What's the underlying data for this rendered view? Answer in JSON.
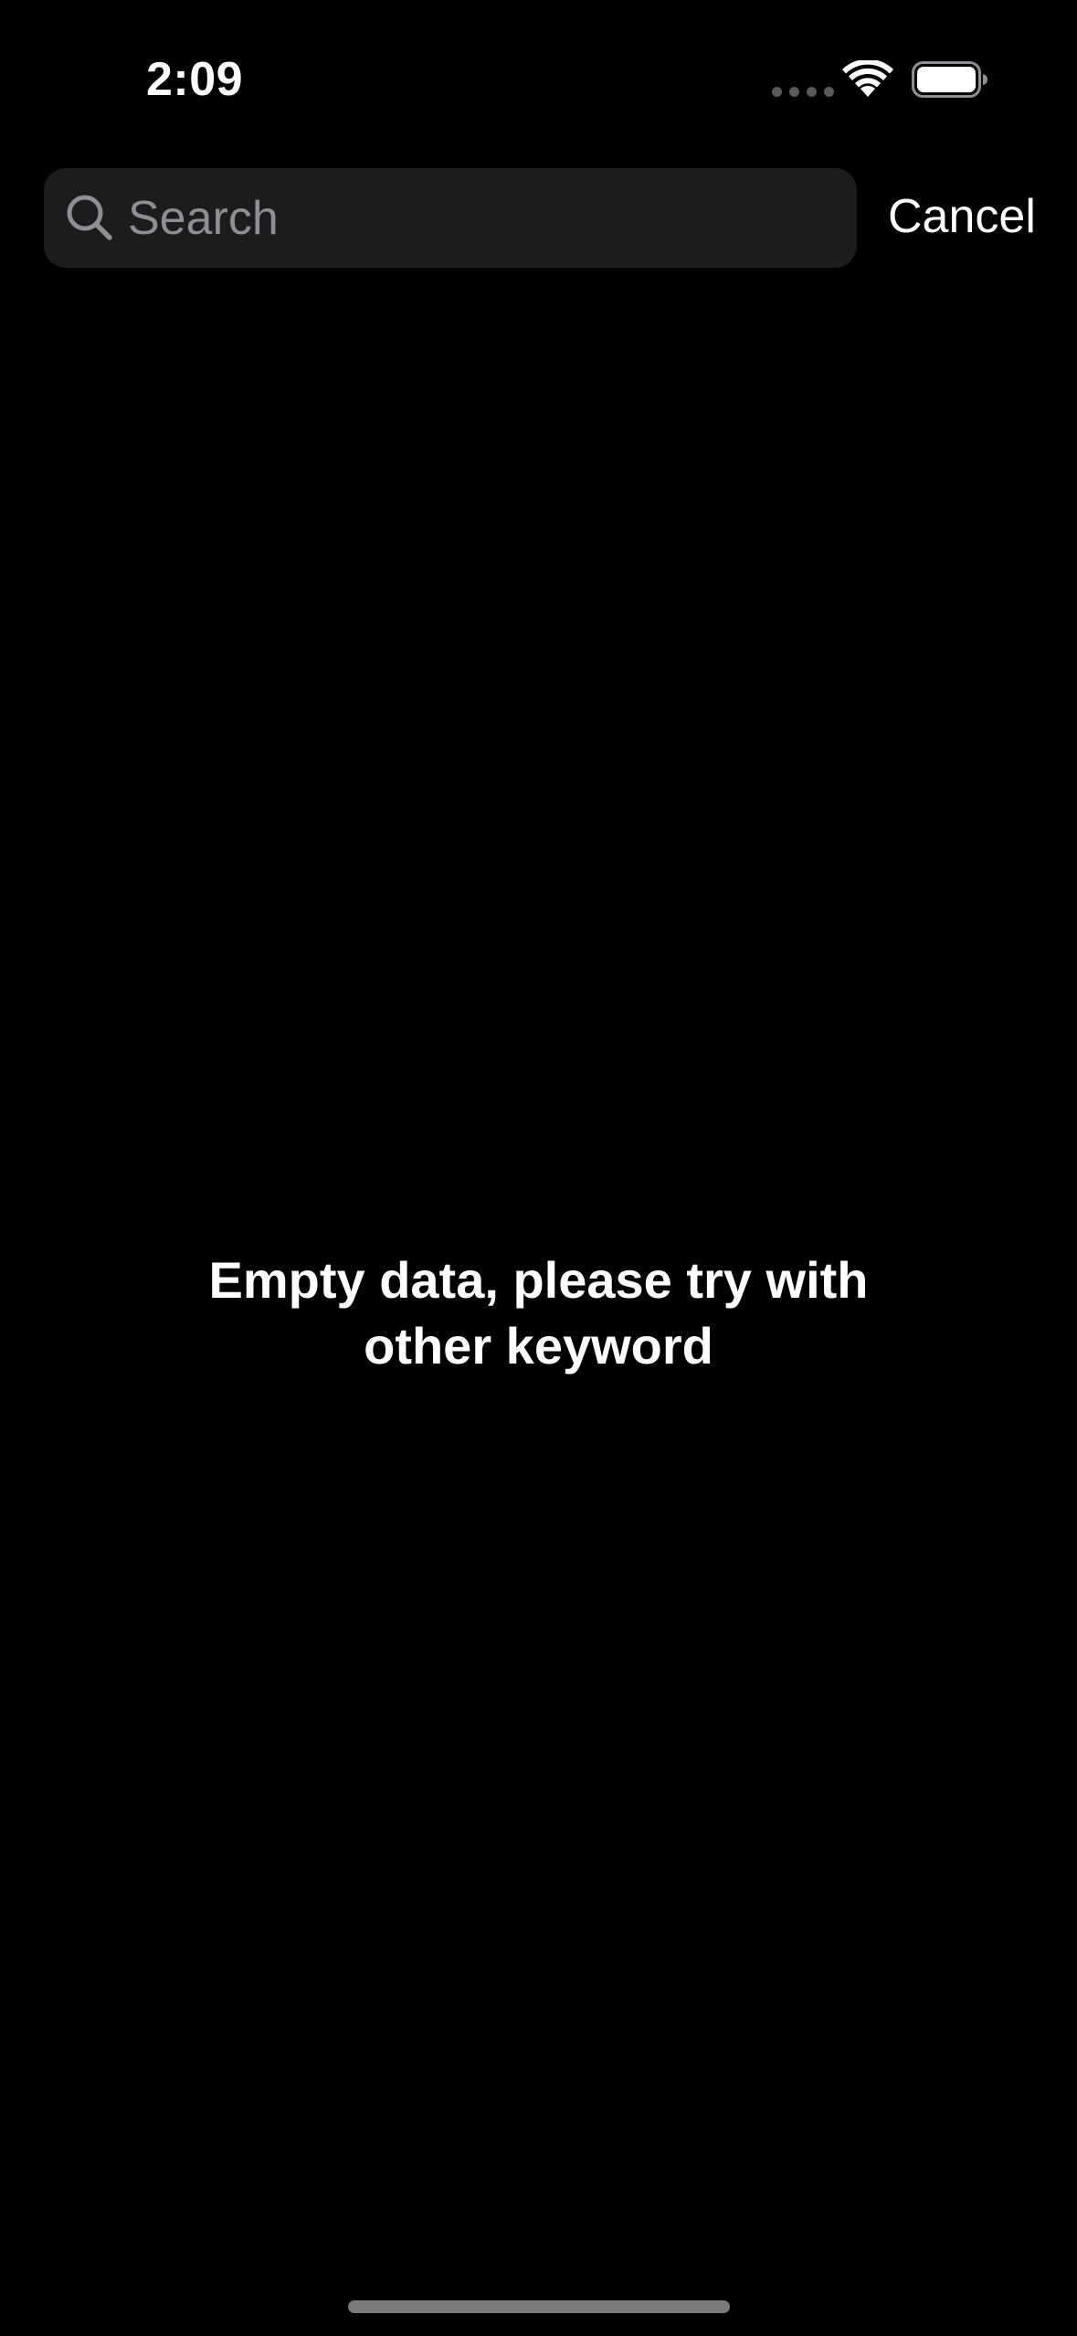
{
  "status_bar": {
    "time": "2:09",
    "icons": [
      "signal-dots-icon",
      "wifi-icon",
      "battery-icon"
    ]
  },
  "search": {
    "placeholder": "Search",
    "value": "",
    "cancel_label": "Cancel"
  },
  "empty_state": {
    "line1": "Empty data, please try with",
    "line2": "other keyword"
  },
  "colors": {
    "background": "#000000",
    "search_field": "#1c1c1e",
    "placeholder": "#8e8e93",
    "text": "#ffffff"
  }
}
